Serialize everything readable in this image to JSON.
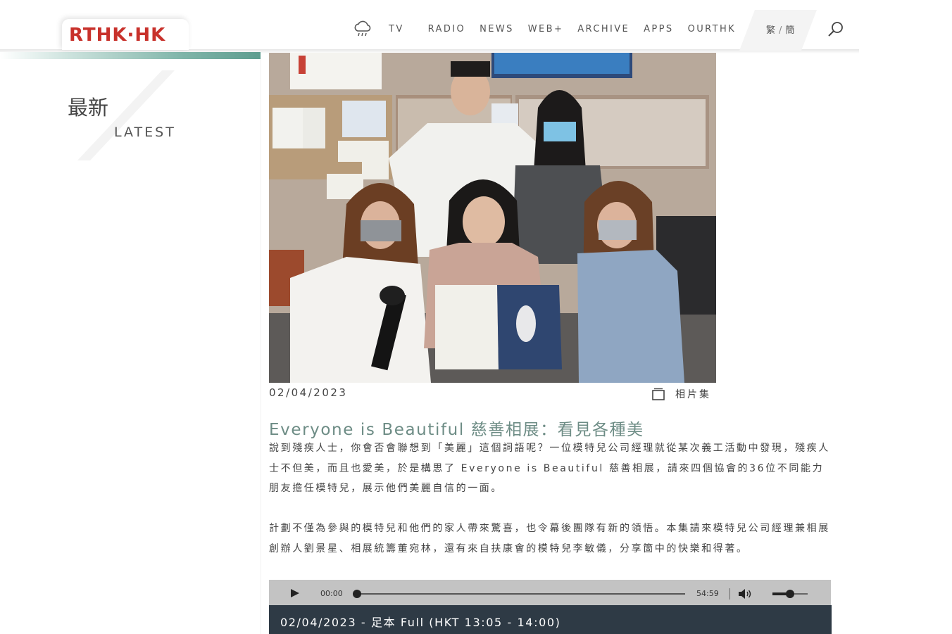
{
  "header": {
    "logo_text": "RTHK·HK",
    "weather_icon": "cloud-rain-icon",
    "nav": [
      {
        "label": "TV"
      },
      {
        "label": "RADIO"
      },
      {
        "label": "NEWS"
      },
      {
        "label": "WEB+"
      },
      {
        "label": "ARCHIVE"
      },
      {
        "label": "APPS"
      },
      {
        "label": "OURTHK"
      }
    ],
    "lang_traditional": "繁",
    "lang_separator": "/",
    "lang_simplified": "簡",
    "search_icon": "search-icon"
  },
  "section": {
    "title_zh": "最新",
    "title_en": "LATEST"
  },
  "article": {
    "date": "02/04/2023",
    "gallery_label": "相片集",
    "title": "Everyone is Beautiful 慈善相展：看見各種美",
    "paragraphs": [
      "說到殘疾人士，你會否會聯想到「美麗」這個詞語呢？一位模特兒公司經理就從某次義工活動中發現，殘疾人士不但美，而且也愛美，於是構思了 Everyone is Beautiful 慈善相展，請來四個協會的36位不同能力朋友擔任模特兒，展示他們美麗自信的一面。",
      "計劃不僅為參與的模特兒和他們的家人帶來驚喜，也令幕後團隊有新的領悟。本集請來模特兒公司經理兼相展創辦人劉景星、相展統籌董宛林，還有來自扶康會的模特兒李敏儀，分享箇中的快樂和得著。"
    ]
  },
  "player": {
    "current_time": "00:00",
    "duration": "54:59",
    "progress": 0,
    "volume": 0.5
  },
  "episode": {
    "label": "02/04/2023 - 足本 Full (HKT 13:05 - 14:00)"
  },
  "colors": {
    "logo_red": "#c8312b",
    "title_teal": "#6d8c85",
    "episode_bar": "#2e3a45",
    "player_bg": "#c3c3c3"
  }
}
